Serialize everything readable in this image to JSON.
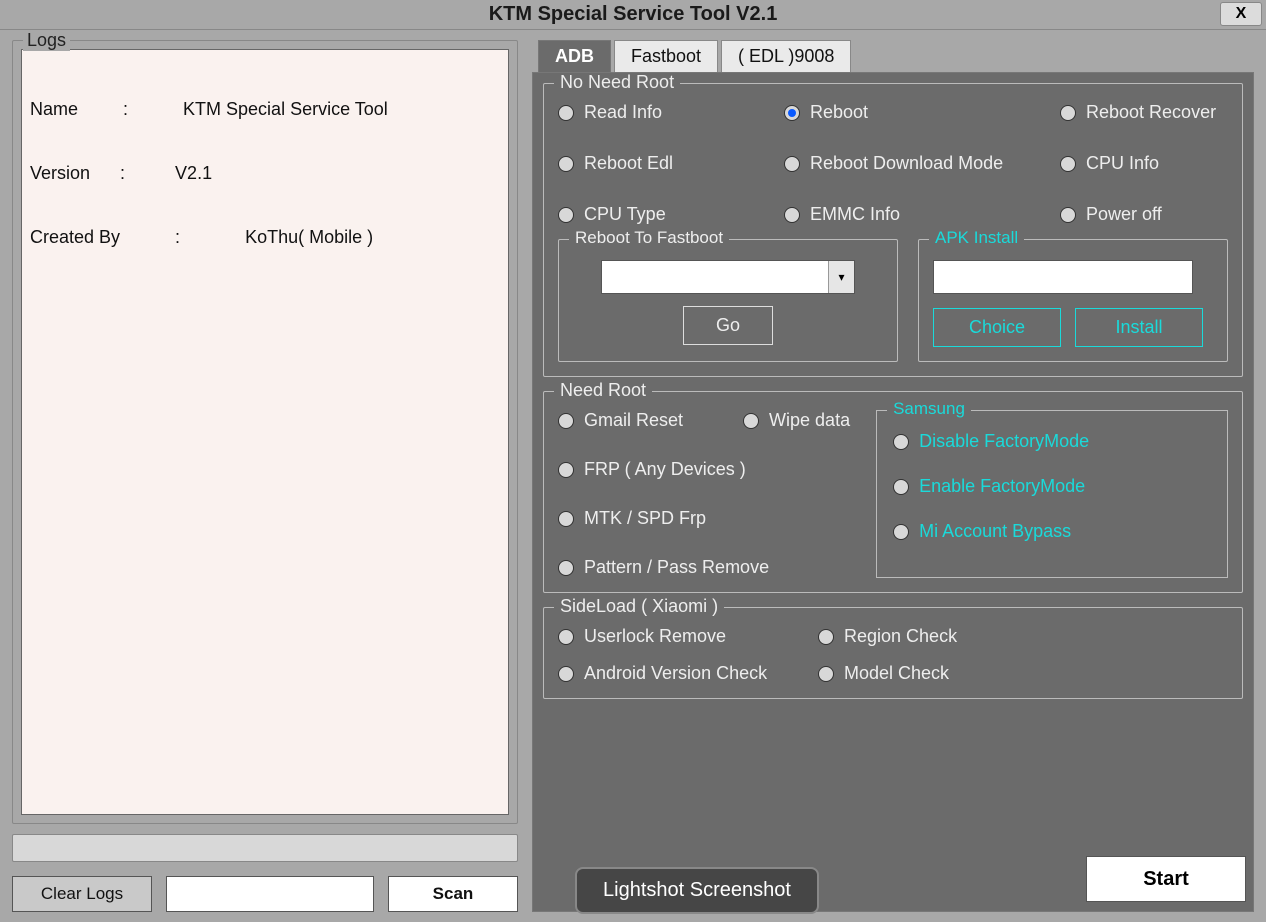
{
  "title": "KTM Special Service Tool V2.1",
  "close": "X",
  "logs": {
    "legend": "Logs",
    "line1": "Name         :           KTM Special Service Tool",
    "line2": "Version      :          V2.1",
    "line3": "Created By           :             KoThu( Mobile )"
  },
  "tabs": {
    "adb": "ADB",
    "fastboot": "Fastboot",
    "edl": "( EDL )9008"
  },
  "noroot": {
    "legend": "No Need Root",
    "read_info": "Read Info",
    "reboot": "Reboot",
    "reboot_recover": "Reboot Recover",
    "reboot_edl": "Reboot Edl",
    "reboot_download": "Reboot Download Mode",
    "cpu_info": "CPU Info",
    "cpu_type": "CPU Type",
    "emmc_info": "EMMC Info",
    "power_off": "Power off",
    "rtf_legend": "Reboot To Fastboot",
    "go": "Go",
    "apk_legend": "APK Install",
    "choice": "Choice",
    "install": "Install"
  },
  "needroot": {
    "legend": "Need Root",
    "gmail_reset": "Gmail Reset",
    "wipe_data": "Wipe data",
    "frp_any": "FRP ( Any Devices )",
    "mtk_spd": "MTK / SPD Frp",
    "pattern": "Pattern / Pass Remove",
    "samsung_legend": "Samsung",
    "disable_fm": "Disable FactoryMode",
    "enable_fm": "Enable FactoryMode",
    "mi_bypass": "Mi Account Bypass"
  },
  "sideload": {
    "legend": "SideLoad ( Xiaomi )",
    "userlock": "Userlock Remove",
    "region": "Region Check",
    "android_ver": "Android Version Check",
    "model": "Model Check"
  },
  "buttons": {
    "clear_logs": "Clear Logs",
    "scan": "Scan",
    "start": "Start"
  },
  "overlay": "Lightshot Screenshot"
}
